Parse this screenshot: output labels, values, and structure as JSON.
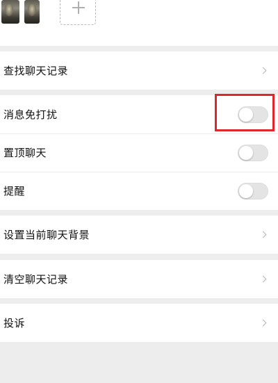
{
  "header": {
    "members": [
      "avatar-1",
      "avatar-2"
    ],
    "add_icon": "plus-icon"
  },
  "settings": {
    "search_history": {
      "label": "查找聊天记录",
      "icon": "chevron-right-icon"
    },
    "do_not_disturb": {
      "label": "消息免打扰",
      "enabled": false
    },
    "pin_chat": {
      "label": "置顶聊天",
      "enabled": false
    },
    "remind": {
      "label": "提醒",
      "enabled": false
    },
    "set_background": {
      "label": "设置当前聊天背景",
      "icon": "chevron-right-icon"
    },
    "clear_history": {
      "label": "清空聊天记录",
      "icon": "chevron-right-icon"
    },
    "report": {
      "label": "投诉",
      "icon": "chevron-right-icon"
    }
  },
  "colors": {
    "highlight": "#e0262a",
    "toggle_off": "#e4e4e4",
    "background": "#ededed"
  }
}
